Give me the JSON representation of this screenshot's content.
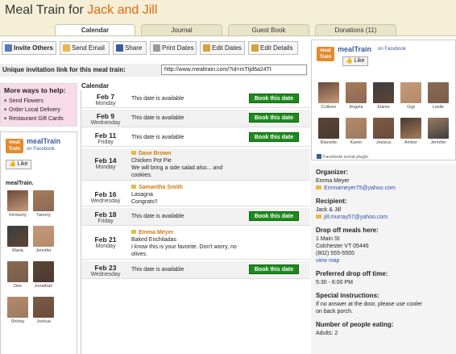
{
  "header": {
    "prefix": "Meal Train for ",
    "names": "Jack and Jill"
  },
  "tabs": [
    {
      "label": "Calendar"
    },
    {
      "label": "Journal"
    },
    {
      "label": "Guest Book"
    },
    {
      "label": "Donations (11)"
    }
  ],
  "toolbar": [
    "Invite Others",
    "Send Email",
    "Share",
    "Print Dates",
    "Edit Dates",
    "Edit Details"
  ],
  "invite": {
    "label": "Unique invitation link for this meal train:",
    "url": "http://www.mealtrain.com/?id=mTtjd6a24Tt"
  },
  "ways": {
    "title": "More ways to help:",
    "items": [
      "Send Flowers",
      "Order Local Delivery",
      "Restaurant Gift Cards"
    ]
  },
  "fb": {
    "logo": "meal Train",
    "name": "mealTrain",
    "sub": "on Facebook",
    "like": "Like",
    "members_label": "mealTrain.",
    "left_people": [
      "Kimberly",
      "Tammy",
      "Maria",
      "Jennifer",
      "Dee",
      "Jonathan",
      "Shirley",
      "Joshua"
    ],
    "right_people": [
      "Colleen",
      "Angela",
      "Elaine",
      "Gigi",
      "Leslie",
      "Blanette",
      "Karen",
      "Jessica",
      "Amber",
      "Jennifer"
    ],
    "plugin": "Facebook social plugin"
  },
  "calendar": {
    "heading": "Calendar",
    "book_label": "Book this date",
    "rows": [
      {
        "date": "Feb 7",
        "day": "Monday",
        "text": "This date is available",
        "booked": false
      },
      {
        "date": "Feb 9",
        "day": "Wednesday",
        "text": "This date is available",
        "booked": false
      },
      {
        "date": "Feb 11",
        "day": "Friday",
        "text": "This date is available",
        "booked": false
      },
      {
        "date": "Feb 14",
        "day": "Monday",
        "who": "Dave Brown",
        "lines": [
          "Chicken Pot Pie",
          "We will bring a side salad also... and",
          "cookies."
        ],
        "booked": true
      },
      {
        "date": "Feb 16",
        "day": "Wednesday",
        "who": "Samantha Smith",
        "lines": [
          "Lasagna",
          "Congrats!!"
        ],
        "booked": true
      },
      {
        "date": "Feb 18",
        "day": "Friday",
        "text": "This date is available",
        "booked": false
      },
      {
        "date": "Feb 21",
        "day": "Monday",
        "who": "Emma Meyer",
        "lines": [
          "Baked Enchiladas",
          "I know this is your favorite. Don't worry, no",
          "olives."
        ],
        "booked": true
      },
      {
        "date": "Feb 23",
        "day": "Wednesday",
        "text": "This date is available",
        "booked": false
      }
    ]
  },
  "info": {
    "organizer_k": "Organizer:",
    "organizer": "Emma Meyer",
    "organizer_email": "Emmameyer75@yahoo.com",
    "recipient_k": "Recipient:",
    "recipient": "Jack & Jill",
    "recipient_email": "jill.murray57@yahoo.com",
    "dropoff_k": "Drop off meals here:",
    "addr1": "1 Main St",
    "addr2": "Colchester VT 05446",
    "phone": "(802) 555-5555",
    "map": "view map",
    "time_k": "Preferred drop off time:",
    "time": "5:30 - 6:00 PM",
    "instr_k": "Special instructions:",
    "instr1": "If no answer at the door, please use cooler",
    "instr2": "on back porch.",
    "people_k": "Number of people eating:",
    "people": "Adults: 2"
  },
  "colors": {
    "brand_orange": "#e06a10",
    "book_green": "#1d8a1d",
    "facebook_blue": "#3b5b9a",
    "panel_cream": "#f4efd6"
  }
}
